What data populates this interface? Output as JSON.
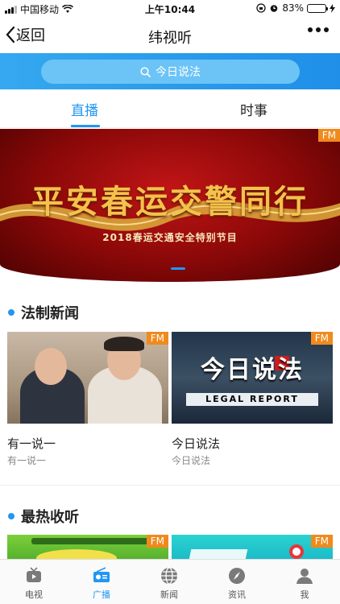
{
  "status_bar": {
    "carrier": "中国移动",
    "time": "上午10:44",
    "battery": "83%",
    "battery_level": 0.83
  },
  "nav": {
    "back_label": "返回",
    "title": "纬视听"
  },
  "search": {
    "placeholder": "今日说法"
  },
  "tabs": [
    {
      "label": "直播",
      "active": true
    },
    {
      "label": "时事",
      "active": false
    }
  ],
  "banner": {
    "title": "平安春运交警同行",
    "subtitle": "2018春运交通安全特别节目",
    "badge": "FM"
  },
  "sections": [
    {
      "title": "法制新闻",
      "cards": [
        {
          "title": "有一说一",
          "subtitle": "有一说一",
          "badge": "FM"
        },
        {
          "title": "今日说法",
          "subtitle": "今日说法",
          "badge": "FM",
          "thumb_text": "今日说法",
          "thumb_subtext": "LEGAL REPORT"
        }
      ]
    },
    {
      "title": "最热收听",
      "cards": [
        {
          "badge": "FM"
        },
        {
          "badge": "FM"
        }
      ]
    }
  ],
  "tab_bar": [
    {
      "label": "电视",
      "icon": "tv-icon",
      "active": false
    },
    {
      "label": "广播",
      "icon": "radio-icon",
      "active": true
    },
    {
      "label": "新闻",
      "icon": "globe-icon",
      "active": false
    },
    {
      "label": "资讯",
      "icon": "compass-icon",
      "active": false
    },
    {
      "label": "我",
      "icon": "user-icon",
      "active": false
    }
  ],
  "colors": {
    "accent": "#2196f3",
    "badge": "#f08a1d",
    "search_band": "#35a8f0"
  }
}
